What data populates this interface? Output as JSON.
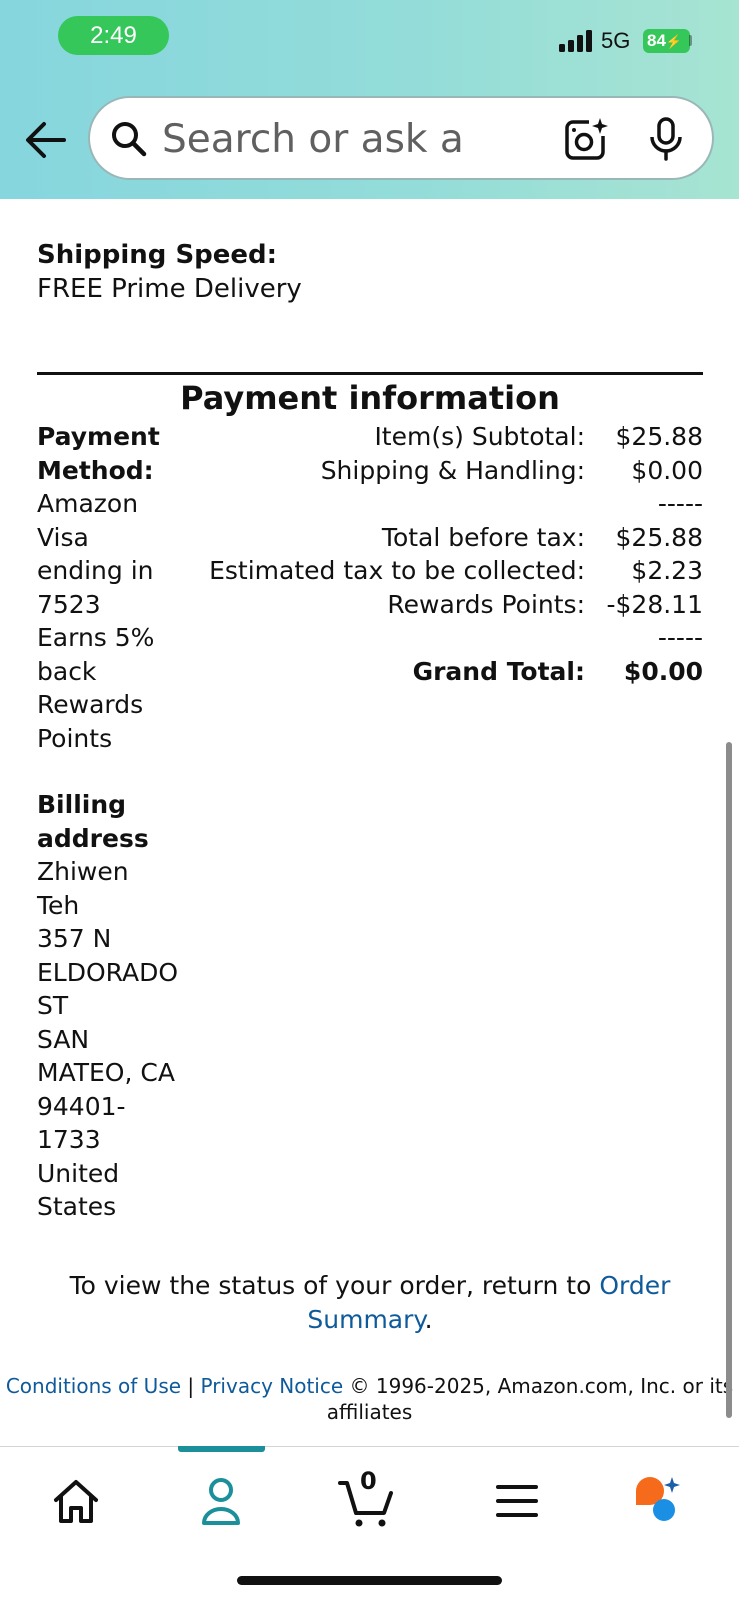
{
  "status_bar": {
    "time": "2:49",
    "network": "5G",
    "battery": "84"
  },
  "search": {
    "placeholder": "Search or ask a q..."
  },
  "shipping": {
    "label": "Shipping Speed:",
    "value": "FREE Prime Delivery"
  },
  "payment": {
    "title": "Payment information",
    "method_label_1": "Payment",
    "method_label_2": "Method:",
    "method_lines": [
      "Amazon",
      "Visa",
      "ending in",
      "7523",
      "Earns 5%",
      "back",
      "Rewards",
      "Points"
    ],
    "totals": [
      {
        "label": "Item(s) Subtotal:",
        "value": "$25.88"
      },
      {
        "label": "Shipping & Handling:",
        "value": "$0.00"
      },
      {
        "label": "",
        "value": "-----"
      },
      {
        "label": "Total before tax:",
        "value": "$25.88"
      },
      {
        "label": "Estimated tax to be collected:",
        "value": "$2.23"
      },
      {
        "label": "Rewards Points:",
        "value": "-$28.11"
      },
      {
        "label": "",
        "value": "-----"
      },
      {
        "label": "Grand Total:",
        "value": "$0.00"
      }
    ]
  },
  "billing": {
    "label_1": "Billing",
    "label_2": "address",
    "lines": [
      "Zhiwen",
      "Teh",
      "357 N",
      "ELDORADO",
      "ST",
      "SAN",
      "MATEO, CA",
      "94401-",
      "1733",
      "United",
      "States"
    ]
  },
  "order_status": {
    "text": "To view the status of your order, return to",
    "link_1": "Order",
    "link_2": "Summary",
    "period": "."
  },
  "footer": {
    "conditions": "Conditions of Use",
    "separator": " | ",
    "privacy": "Privacy Notice",
    "copyright": " © 1996-2025, Amazon.com, Inc. or its",
    "line2": "affiliates"
  },
  "tabbar": {
    "cart_count": "0",
    "active_tab": "account",
    "accent_color": "#1b8f9a"
  },
  "colors": {
    "link": "#0f5a9a",
    "status_green": "#35c759"
  }
}
